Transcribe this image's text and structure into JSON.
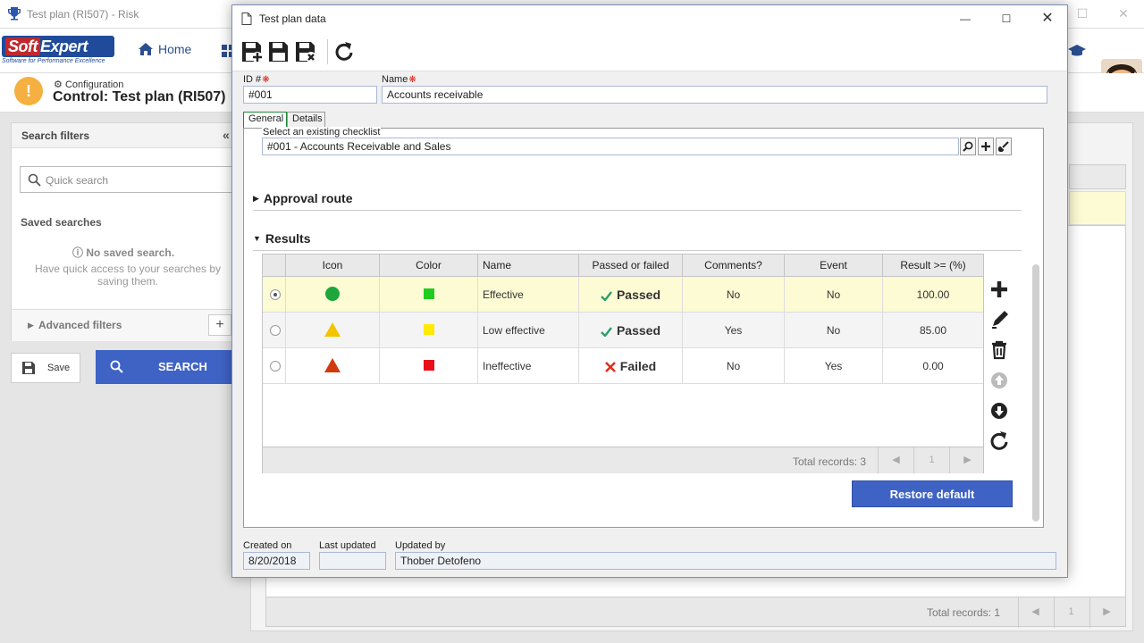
{
  "background": {
    "window_title": "Test plan (RI507) - Risk",
    "logo": {
      "brand": "SoftExpert",
      "brand_soft": "Soft",
      "brand_expert": "Expert",
      "tagline": "Software for Performance Excellence"
    },
    "nav": {
      "home": "Home"
    },
    "breadcrumb": "Configuration",
    "page_title": "Control: Test plan (RI507)",
    "sidebar": {
      "title": "Search filters",
      "quick_search_placeholder": "Quick search",
      "saved_searches": "Saved searches",
      "no_saved": "No saved search.",
      "no_saved_desc": "Have quick access to your searches by saving them.",
      "advanced_filters": "Advanced filters"
    },
    "save_label": "Save",
    "search_label": "SEARCH",
    "main_grid": {
      "total_records": "Total records: 1",
      "page": "1"
    }
  },
  "dialog": {
    "title": "Test plan data",
    "fields": {
      "id_label": "ID #",
      "id_value": "#001",
      "name_label": "Name",
      "name_value": "Accounts receivable"
    },
    "tabs": [
      "General",
      "Details"
    ],
    "checklist": {
      "label": "Select an existing checklist",
      "value": "#001 - Accounts Receivable and Sales"
    },
    "sections": {
      "approval_route": "Approval route",
      "results": "Results"
    },
    "results_grid": {
      "columns": [
        "Icon",
        "Color",
        "Name",
        "Passed or failed",
        "Comments?",
        "Event",
        "Result >= (%)"
      ],
      "rows": [
        {
          "selected": true,
          "icon": "green-circle",
          "color": "#1fcc1f",
          "name": "Effective",
          "status": "Passed",
          "comments": "No",
          "event": "No",
          "result": "100.00"
        },
        {
          "selected": false,
          "icon": "yellow-triangle",
          "color": "#ffea00",
          "name": "Low effective",
          "status": "Passed",
          "comments": "Yes",
          "event": "No",
          "result": "85.00"
        },
        {
          "selected": false,
          "icon": "red-triangle",
          "color": "#e8101a",
          "name": "Ineffective",
          "status": "Failed",
          "comments": "No",
          "event": "Yes",
          "result": "0.00"
        }
      ],
      "total_records": "Total records: 3",
      "page": "1"
    },
    "restore_default": "Restore default",
    "footer": {
      "created_on_label": "Created on",
      "created_on_value": "8/20/2018",
      "last_updated_label": "Last updated",
      "last_updated_value": "",
      "updated_by_label": "Updated by",
      "updated_by_value": "Thober Detofeno"
    },
    "colors": {
      "accent": "#3f63c5",
      "row_selected": "#fdfbd3",
      "passed": "#2e9e6a",
      "failed": "#d9331e"
    }
  }
}
